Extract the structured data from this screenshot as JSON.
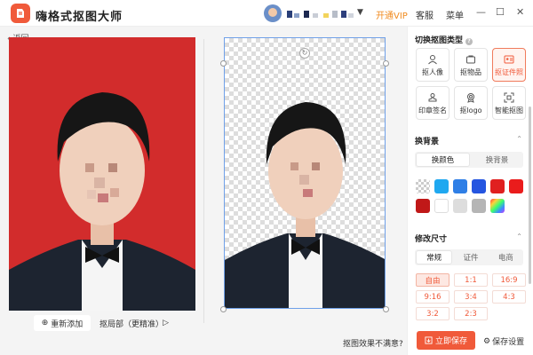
{
  "app": {
    "title": "嗨格式抠图大师"
  },
  "header": {
    "vip_label": "开通VIP",
    "service_label": "客服",
    "menu_label": "菜单",
    "dropdown_glyph": "▼",
    "min_glyph": "—",
    "max_glyph": "☐",
    "close_glyph": "✕"
  },
  "canvas": {
    "back_label": "返回",
    "add_button_label": "重新添加",
    "refine_button_label": "抠局部（更精准）",
    "unsatisfied_label": "抠图效果不满意?"
  },
  "panel": {
    "cutout_type_title": "切换抠图类型",
    "cutout_types": [
      {
        "label": "抠人像",
        "icon": "person-icon",
        "active": false
      },
      {
        "label": "抠物品",
        "icon": "item-icon",
        "active": false
      },
      {
        "label": "抠证件照",
        "icon": "id-photo-icon",
        "active": true
      },
      {
        "label": "印章签名",
        "icon": "stamp-icon",
        "active": false
      },
      {
        "label": "抠logo",
        "icon": "logo-icon",
        "active": false
      },
      {
        "label": "智能抠图",
        "icon": "smart-cutout-icon",
        "active": false
      }
    ],
    "background_title": "换背景",
    "background_tabs": [
      "换颜色",
      "换背景"
    ],
    "background_active_tab": "换颜色",
    "colors": [
      "transparent",
      "#1fa8f0",
      "#2f7fe6",
      "#2555e0",
      "#e02020",
      "#ea1c1c",
      "#c01818",
      "#ffffff",
      "#dddddd",
      "#b5b5b5",
      "gradient"
    ],
    "size_title": "修改尺寸",
    "size_tabs": [
      "常规",
      "证件",
      "电商"
    ],
    "size_active_tab": "常规",
    "ratios": [
      "自由",
      "1:1",
      "16:9",
      "9:16",
      "3:4",
      "4:3",
      "3:2",
      "2:3"
    ],
    "ratio_active": "自由",
    "save_label": "立即保存",
    "save_settings_label": "保存设置"
  },
  "colors": {
    "accent": "#f05a3a",
    "vip": "#f08a1e",
    "photo_background": "#d22c2c"
  }
}
